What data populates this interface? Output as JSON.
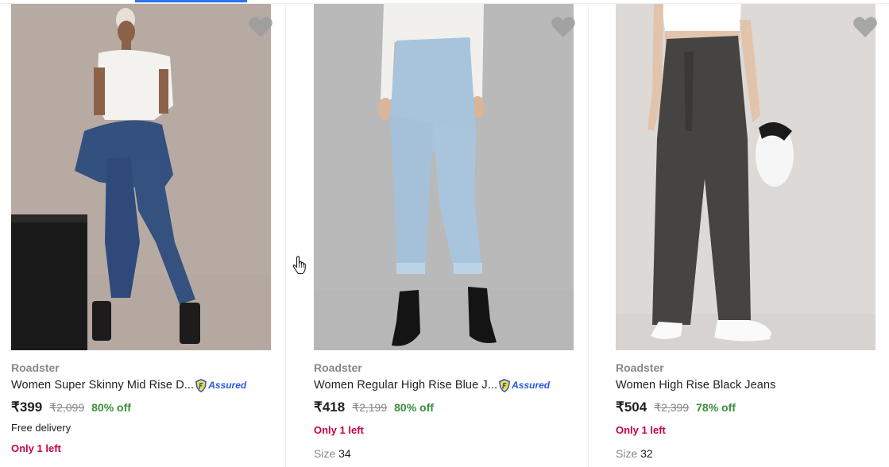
{
  "colors": {
    "accent": "#2874f0",
    "discount": "#388e3c",
    "stock_alert": "#c7004b",
    "assured": "#2a55e5",
    "muted": "#878787"
  },
  "products": [
    {
      "brand": "Roadster",
      "title": "Women Super Skinny Mid Rise D...",
      "assured_label": "Assured",
      "price": "₹399",
      "mrp": "₹2,099",
      "discount": "80% off",
      "delivery": "Free delivery",
      "stock": "Only 1 left",
      "image_icon": "product-photo-icon"
    },
    {
      "brand": "Roadster",
      "title": "Women Regular High Rise Blue J...",
      "assured_label": "Assured",
      "price": "₹418",
      "mrp": "₹2,199",
      "discount": "80% off",
      "stock": "Only 1 left",
      "size_label": "Size",
      "size_value": "34",
      "image_icon": "product-photo-icon"
    },
    {
      "brand": "Roadster",
      "title": "Women High Rise Black Jeans",
      "price": "₹504",
      "mrp": "₹2,399",
      "discount": "78% off",
      "stock": "Only 1 left",
      "size_label": "Size",
      "size_value": "32",
      "image_icon": "product-photo-icon"
    }
  ],
  "icons": {
    "wishlist": "heart-icon",
    "assured": "assured-badge-icon",
    "pointer": "hand-cursor-icon"
  }
}
